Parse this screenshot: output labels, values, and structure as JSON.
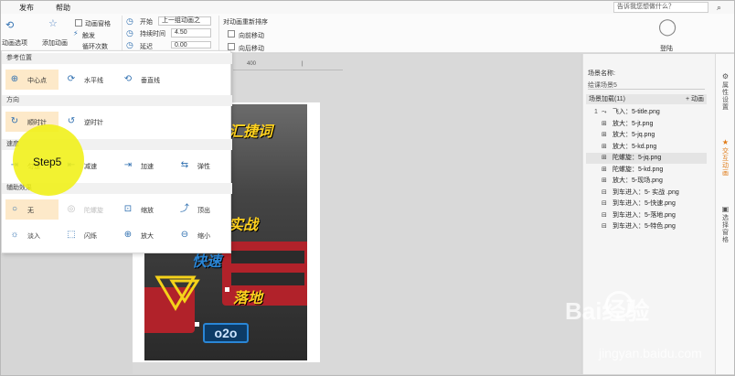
{
  "menubar": {
    "publish": "发布",
    "help": "帮助",
    "search_placeholder": "告诉我您想做什么？"
  },
  "ribbon": {
    "anim_options": "动画选项",
    "add_anim": "添加动画",
    "anim_pane": "动画窗格",
    "trigger": "触发",
    "effect_partial": "循环次数",
    "start_label": "开始",
    "start_value": "上一组动画之",
    "duration_label": "持续时间",
    "duration_value": "4.50",
    "delay_label": "延迟",
    "delay_value": "0.00",
    "reorder_title": "对动画重新排序",
    "move_forward": "向前移动",
    "move_backward": "向后移动",
    "login": "登陆"
  },
  "ruler": {
    "mark": "400",
    "mark2": "|"
  },
  "panel": {
    "ref_position": "参考位置",
    "ref_items": [
      "中心点",
      "水平线",
      "垂直线"
    ],
    "direction": "方向",
    "dir_items": [
      "顺时针",
      "逆时针"
    ],
    "speed": "速度",
    "speed_items": [
      "匀速",
      "减速",
      "加速",
      "弹性"
    ],
    "aux": "辅助效果",
    "aux_items": [
      "无",
      "陀螺旋",
      "缩放",
      "顶出",
      "淡入",
      "闪烁",
      "放大",
      "缩小"
    ]
  },
  "step_label": "Step5",
  "slide_words": [
    "汇捷词",
    "实战",
    "快速",
    "落地",
    "o2o"
  ],
  "right_panel": {
    "scene_name_label": "场景名称:",
    "scene_name_value": "绘课场景5",
    "list_header": "场景加载(11)",
    "anim_btn": "+ 动画",
    "rows": [
      {
        "num": "1",
        "text": "飞入：5-title.png"
      },
      {
        "num": "",
        "text": "放大：5-jt.png"
      },
      {
        "num": "",
        "text": "放大：5-jq.png"
      },
      {
        "num": "",
        "text": "放大：5-kd.png"
      },
      {
        "num": "",
        "text": "陀螺旋：5-jq.png"
      },
      {
        "num": "",
        "text": "陀螺旋：5-kd.png"
      },
      {
        "num": "",
        "text": "放大：5-现场.png"
      },
      {
        "num": "",
        "text": "到车进入：5- 实战 .png"
      },
      {
        "num": "",
        "text": "到车进入：5-快速.png"
      },
      {
        "num": "",
        "text": "到车进入：5-落地.png"
      },
      {
        "num": "",
        "text": "到车进入：5-特色.png"
      }
    ]
  },
  "rail": {
    "props": "属性设置",
    "interact": "交互动画",
    "select": "选择窗格"
  },
  "watermark": {
    "brand": "Bai经验",
    "url": "jingyan.baidu.com"
  }
}
